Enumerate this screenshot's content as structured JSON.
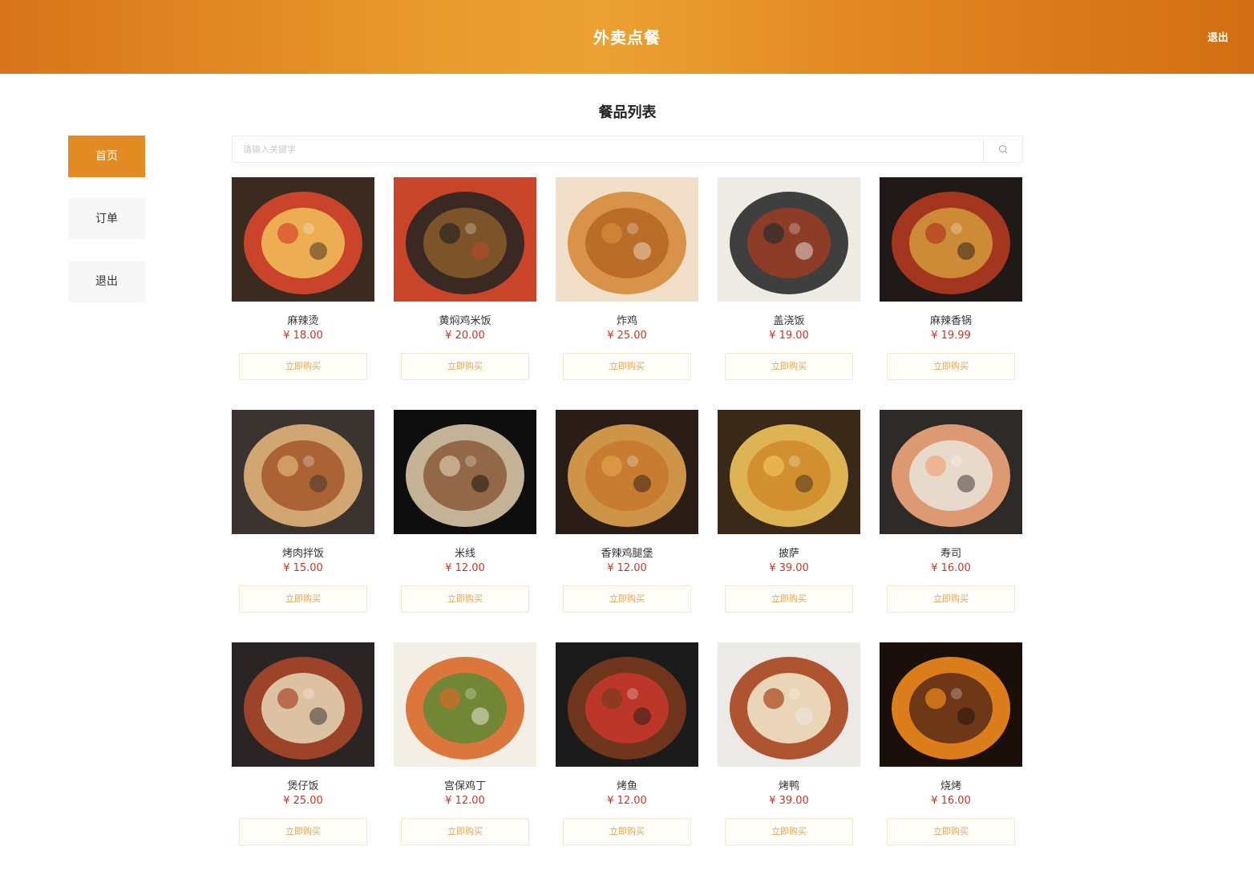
{
  "header": {
    "title": "外卖点餐",
    "logout": "退出"
  },
  "sidebar": {
    "items": [
      {
        "label": "首页",
        "active": true
      },
      {
        "label": "订单",
        "active": false
      },
      {
        "label": "退出",
        "active": false
      }
    ]
  },
  "main": {
    "title": "餐品列表",
    "search": {
      "placeholder": "请输入关键字",
      "value": ""
    }
  },
  "buy_label": "立即购买",
  "foods": [
    {
      "name": "麻辣烫",
      "price": "¥ 18.00",
      "image": "mala-tang",
      "colors": [
        "#3a2a20",
        "#d9472b",
        "#f2c05a"
      ]
    },
    {
      "name": "黄焖鸡米饭",
      "price": "¥ 20.00",
      "image": "braised-chicken-rice",
      "colors": [
        "#c8452a",
        "#2a2622",
        "#8a5a2c"
      ]
    },
    {
      "name": "炸鸡",
      "price": "¥ 25.00",
      "image": "fried-chicken",
      "colors": [
        "#f1dfc9",
        "#d68b3a",
        "#b46624"
      ]
    },
    {
      "name": "盖浇饭",
      "price": "¥ 19.00",
      "image": "rice-bowl",
      "colors": [
        "#eeeae4",
        "#2c2c2c",
        "#9b3c24"
      ]
    },
    {
      "name": "麻辣香锅",
      "price": "¥ 19.99",
      "image": "spicy-pot",
      "colors": [
        "#1f1a18",
        "#b3391f",
        "#d69a3c"
      ]
    },
    {
      "name": "烤肉拌饭",
      "price": "¥ 15.00",
      "image": "bbq-rice",
      "colors": [
        "#3a3330",
        "#e2b27a",
        "#a4562a"
      ]
    },
    {
      "name": "米线",
      "price": "¥ 12.00",
      "image": "rice-noodles",
      "colors": [
        "#0e0e0e",
        "#d8c4a6",
        "#8b5a3a"
      ]
    },
    {
      "name": "香辣鸡腿堡",
      "price": "¥ 12.00",
      "image": "chicken-burger",
      "colors": [
        "#2a1c16",
        "#e0a24d",
        "#c7782e"
      ]
    },
    {
      "name": "披萨",
      "price": "¥ 39.00",
      "image": "pizza",
      "colors": [
        "#3a2918",
        "#f0c25a",
        "#d08a2c"
      ]
    },
    {
      "name": "寿司",
      "price": "¥ 16.00",
      "image": "sushi",
      "colors": [
        "#2e2a28",
        "#f1a57a",
        "#e9e4dc"
      ]
    },
    {
      "name": "煲仔饭",
      "price": "¥ 25.00",
      "image": "claypot-rice",
      "colors": [
        "#2a2524",
        "#a9472a",
        "#e8d8b8"
      ]
    },
    {
      "name": "宫保鸡丁",
      "price": "¥ 12.00",
      "image": "kungpao-chicken",
      "colors": [
        "#f4efe6",
        "#d8692a",
        "#5e8a34"
      ]
    },
    {
      "name": "烤鱼",
      "price": "¥ 12.00",
      "image": "grilled-fish",
      "colors": [
        "#1c1b1b",
        "#7a3a1e",
        "#c9362b"
      ]
    },
    {
      "name": "烤鸭",
      "price": "¥ 39.00",
      "image": "roast-duck",
      "colors": [
        "#eceae6",
        "#a7441d",
        "#f4ecd0"
      ]
    },
    {
      "name": "烧烤",
      "price": "¥ 16.00",
      "image": "barbecue",
      "colors": [
        "#1a0f0a",
        "#f08a1c",
        "#5a2a18"
      ]
    }
  ]
}
